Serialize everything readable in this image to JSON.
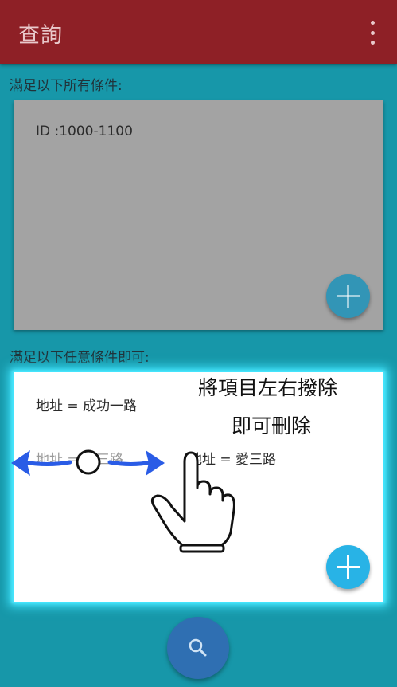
{
  "app_bar": {
    "title": "查詢",
    "menu_icon": "more-vert-icon"
  },
  "all_conditions": {
    "label": "滿足以下所有條件:",
    "items": [
      "ID  :1000-1100"
    ],
    "add_icon": "add-icon"
  },
  "any_conditions": {
    "label": "滿足以下任意條件即可:",
    "items": [
      "地址 =  成功一路",
      "地址 =  愛三路",
      "地址 =  愛三路"
    ],
    "add_icon": "add-icon"
  },
  "hint": {
    "line1": "將項目左右撥除",
    "line2": "即可刪除"
  },
  "search_button": {
    "icon": "search-icon"
  },
  "colors": {
    "app_bar": "#8e2026",
    "background": "#1797a9",
    "card_all": "#a3a3a3",
    "card_any": "#ffffff",
    "highlight_glow": "#3fe6ff",
    "fab_add": "#28b3e6",
    "fab_search": "#2f6fb2",
    "swipe_arrows": "#2a5ce6"
  }
}
